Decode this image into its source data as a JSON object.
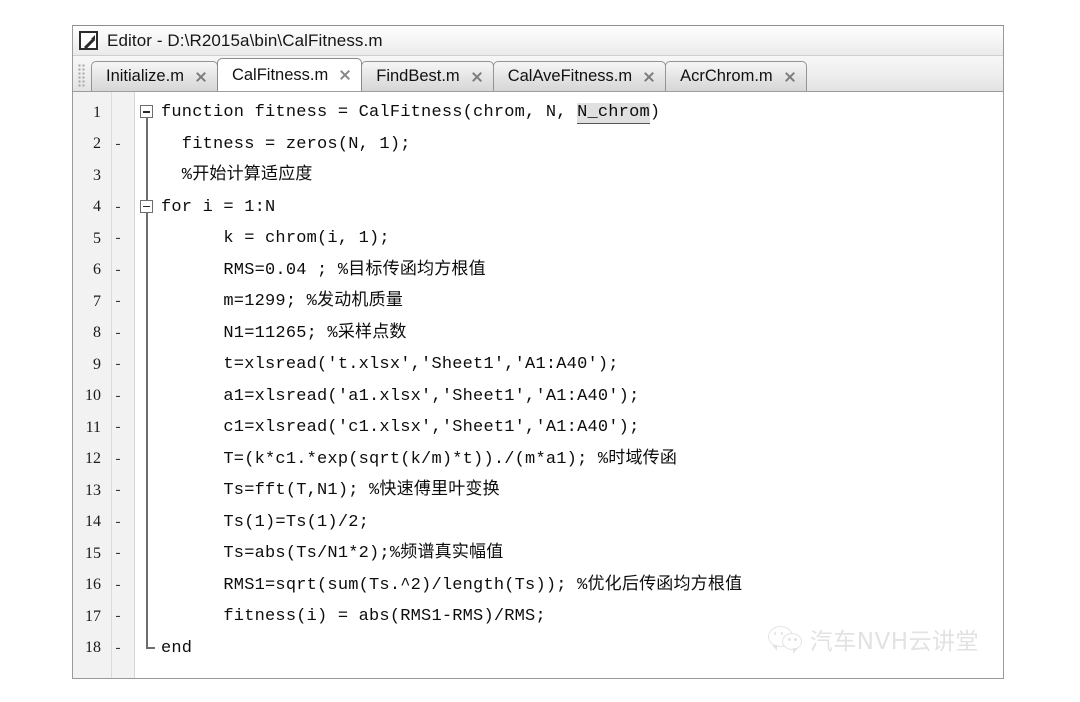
{
  "window": {
    "title": "Editor - D:\\R2015a\\bin\\CalFitness.m",
    "icon": "editor-pencil-icon"
  },
  "tabs": [
    {
      "label": "Initialize.m",
      "active": false,
      "close": "close-icon"
    },
    {
      "label": "CalFitness.m",
      "active": true,
      "close": "close-icon"
    },
    {
      "label": "FindBest.m",
      "active": false,
      "close": "close-icon"
    },
    {
      "label": "CalAveFitness.m",
      "active": false,
      "close": "close-icon"
    },
    {
      "label": "AcrChrom.m",
      "active": false,
      "close": "close-icon"
    }
  ],
  "editor": {
    "lines": [
      {
        "num": "1",
        "bp": "",
        "code": "function fitness = CalFitness(chrom, N, ",
        "highlight": "N_chrom",
        "code_after": ")"
      },
      {
        "num": "2",
        "bp": "-",
        "code": "  fitness = zeros(N, 1);"
      },
      {
        "num": "3",
        "bp": "",
        "code": "  %开始计算适应度"
      },
      {
        "num": "4",
        "bp": "-",
        "code": "for i = 1:N"
      },
      {
        "num": "5",
        "bp": "-",
        "code": "      k = chrom(i, 1);"
      },
      {
        "num": "6",
        "bp": "-",
        "code": "      RMS=0.04 ; %目标传函均方根值"
      },
      {
        "num": "7",
        "bp": "-",
        "code": "      m=1299; %发动机质量"
      },
      {
        "num": "8",
        "bp": "-",
        "code": "      N1=11265; %采样点数"
      },
      {
        "num": "9",
        "bp": "-",
        "code": "      t=xlsread('t.xlsx','Sheet1','A1:A40');"
      },
      {
        "num": "10",
        "bp": "-",
        "code": "      a1=xlsread('a1.xlsx','Sheet1','A1:A40');"
      },
      {
        "num": "11",
        "bp": "-",
        "code": "      c1=xlsread('c1.xlsx','Sheet1','A1:A40');"
      },
      {
        "num": "12",
        "bp": "-",
        "code": "      T=(k*c1.*exp(sqrt(k/m)*t))./(m*a1); %时域传函"
      },
      {
        "num": "13",
        "bp": "-",
        "code": "      Ts=fft(T,N1); %快速傅里叶变换"
      },
      {
        "num": "14",
        "bp": "-",
        "code": "      Ts(1)=Ts(1)/2;"
      },
      {
        "num": "15",
        "bp": "-",
        "code": "      Ts=abs(Ts/N1*2);%频谱真实幅值"
      },
      {
        "num": "16",
        "bp": "-",
        "code": "      RMS1=sqrt(sum(Ts.^2)/length(Ts)); %优化后传函均方根值"
      },
      {
        "num": "17",
        "bp": "-",
        "code": "      fitness(i) = abs(RMS1-RMS)/RMS;"
      },
      {
        "num": "18",
        "bp": "-",
        "code": "end"
      }
    ]
  },
  "watermark": {
    "text": "汽车NVH云讲堂",
    "logo": "wechat-logo-icon"
  },
  "colors": {
    "window_border": "#9a9a9a",
    "gutter_bg": "#f2f2f2",
    "active_tab_bg": "#ffffff",
    "inactive_tab_bg": "#e7e7e7",
    "code_text": "#0d0d0d",
    "highlight_bg": "#e0e0e0",
    "watermark": "#b5b5b5"
  }
}
